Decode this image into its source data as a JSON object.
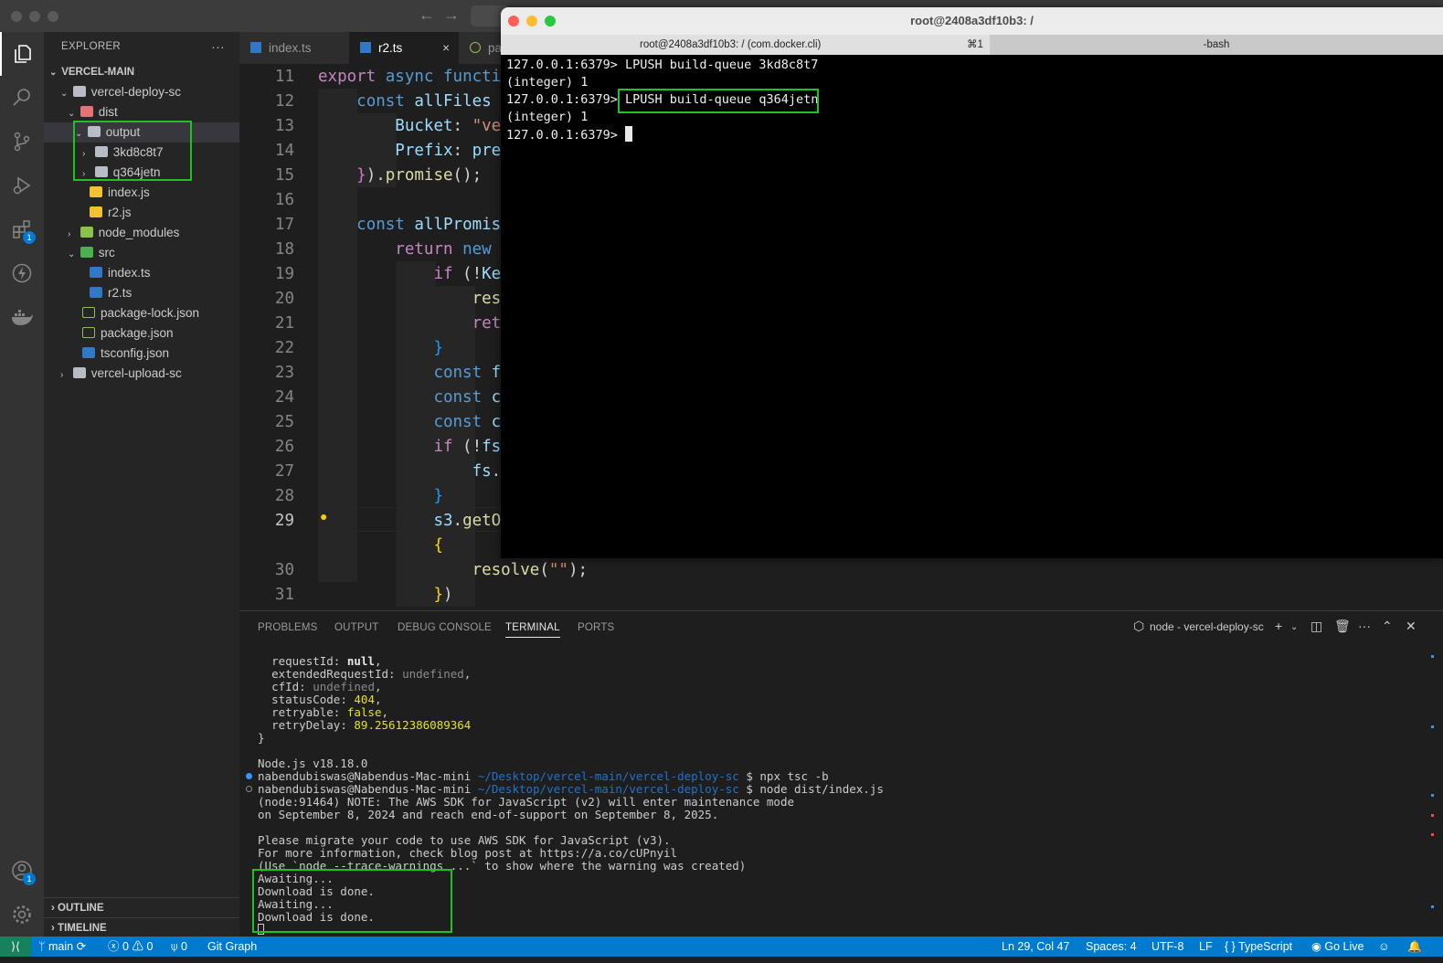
{
  "terminal_window": {
    "title": "root@2408a3df10b3: /",
    "tab_main": "root@2408a3df10b3: / (com.docker.cli)",
    "tab_shortcut": "⌘1",
    "tab_second": "-bash",
    "lines": [
      "127.0.0.1:6379> LPUSH build-queue 3kd8c8t7",
      "(integer) 1",
      "127.0.0.1:6379> LPUSH build-queue q364jetn",
      "(integer) 1",
      "127.0.0.1:6379> "
    ]
  },
  "sidebar": {
    "title": "EXPLORER",
    "more": "···",
    "root": "VERCEL-MAIN",
    "tree": [
      {
        "label": "vercel-deploy-sc"
      },
      {
        "label": "dist"
      },
      {
        "label": "output"
      },
      {
        "label": "3kd8c8t7"
      },
      {
        "label": "q364jetn"
      },
      {
        "label": "index.js"
      },
      {
        "label": "r2.js"
      },
      {
        "label": "node_modules"
      },
      {
        "label": "src"
      },
      {
        "label": "index.ts"
      },
      {
        "label": "r2.ts"
      },
      {
        "label": "package-lock.json"
      },
      {
        "label": "package.json"
      },
      {
        "label": "tsconfig.json"
      },
      {
        "label": "vercel-upload-sc"
      }
    ],
    "outline": "OUTLINE",
    "timeline": "TIMELINE"
  },
  "activity": {
    "extensions_badge": "1",
    "accounts_badge": "1"
  },
  "tabs": [
    {
      "label": "index.ts"
    },
    {
      "label": "r2.ts",
      "close": "×"
    },
    {
      "label": "pa"
    }
  ],
  "editor": {
    "line_numbers": [
      "11",
      "12",
      "13",
      "14",
      "15",
      "16",
      "17",
      "18",
      "19",
      "20",
      "21",
      "22",
      "23",
      "24",
      "25",
      "26",
      "27",
      "28",
      "29",
      "30",
      "31"
    ]
  },
  "panel": {
    "tabs": [
      "PROBLEMS",
      "OUTPUT",
      "DEBUG CONSOLE",
      "TERMINAL",
      "PORTS"
    ],
    "active_tab": "TERMINAL",
    "terminal_name": "node - vercel-deploy-sc",
    "terminal": {
      "requestId_key": "requestId:",
      "requestId_val": "null",
      "extendedRequestId_key": "extendedRequestId:",
      "extendedRequestId_val": "undefined",
      "cfId_key": "cfId:",
      "cfId_val": "undefined",
      "statusCode_key": "statusCode:",
      "statusCode_val": "404",
      "retryable_key": "retryable:",
      "retryable_val": "false",
      "retryDelay_key": "retryDelay:",
      "retryDelay_val": "89.25612386089364",
      "close_brace": "}",
      "node_version": "Node.js v18.18.0",
      "prompt_user": "nabendubiswas@Nabendus-Mac-mini",
      "prompt_path": "~/Desktop/vercel-main/vercel-deploy-sc",
      "cmd1": "$ npx tsc -b",
      "cmd2": "$ node dist/index.js",
      "note1": "(node:91464) NOTE: The AWS SDK for JavaScript (v2) will enter maintenance mode",
      "note2": "on September 8, 2024 and reach end-of-support on September 8, 2025.",
      "migrate1": "Please migrate your code to use AWS SDK for JavaScript (v3).",
      "migrate2": "For more information, check blog post at https://a.co/cUPnyil",
      "migrate3": "(Use `node --trace-warnings ...` to show where the warning was created)",
      "out1": "Awaiting...",
      "out2": "Download is done.",
      "out3": "Awaiting...",
      "out4": "Download is done."
    }
  },
  "statusbar": {
    "branch": "main",
    "errors": "0",
    "warnings": "0",
    "ports": "0",
    "git_graph": "Git Graph",
    "position": "Ln 29, Col 47",
    "spaces": "Spaces: 4",
    "encoding": "UTF-8",
    "eol": "LF",
    "language": "TypeScript",
    "golive": "Go Live"
  },
  "colors": {
    "highlight_box": "#1ec31e",
    "statusbar": "#007acc",
    "editor_bg": "#1e1e1e"
  }
}
